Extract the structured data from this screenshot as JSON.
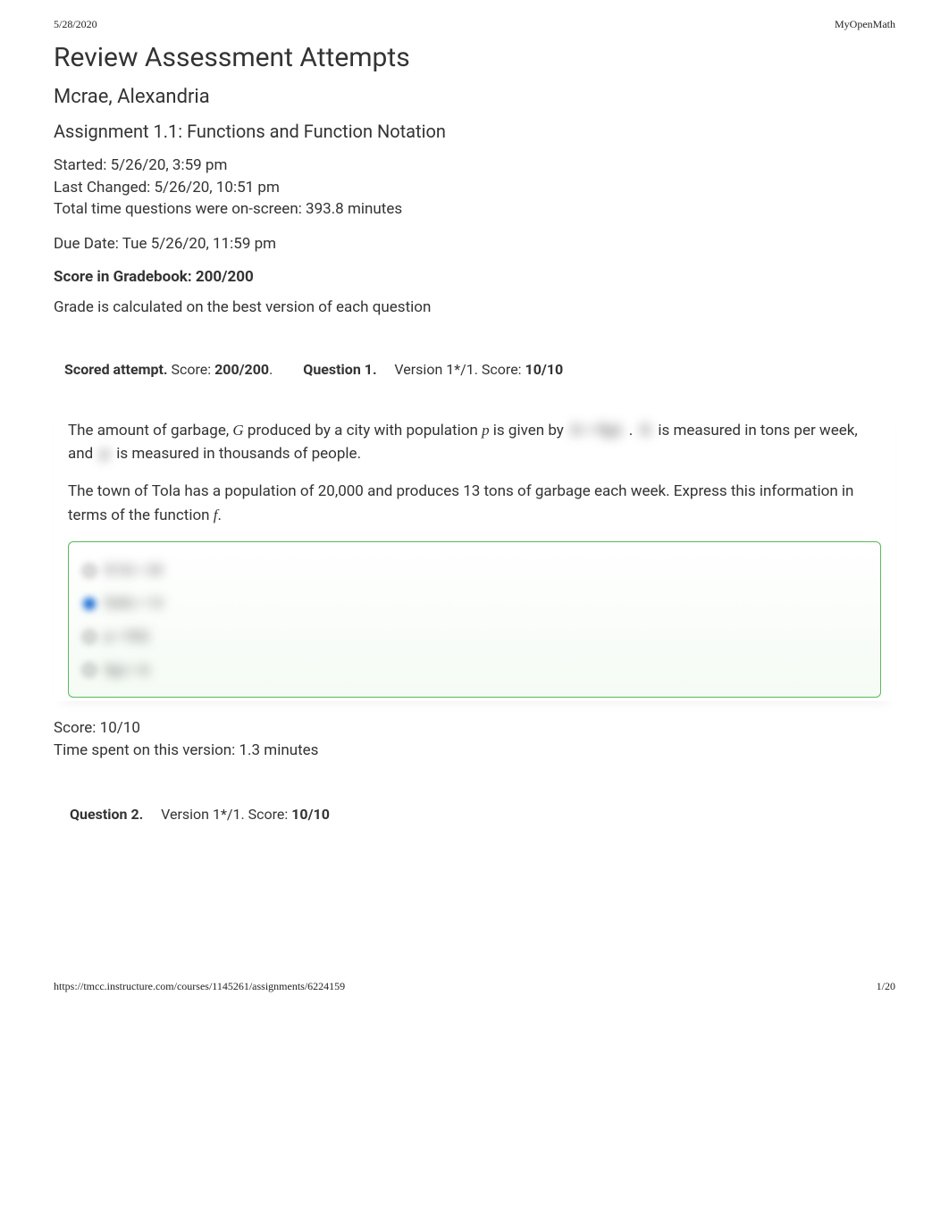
{
  "header": {
    "date": "5/28/2020",
    "app_name": "MyOpenMath"
  },
  "title": "Review Assessment Attempts",
  "student": "Mcrae, Alexandria",
  "assignment": "Assignment 1.1: Functions and Function Notation",
  "meta": {
    "started": "Started: 5/26/20, 3:59 pm",
    "last_changed": "Last Changed: 5/26/20, 10:51 pm",
    "time_onscreen": "Total time questions were on-screen: 393.8 minutes",
    "due_date": "Due Date: Tue 5/26/20, 11:59 pm"
  },
  "gradebook": {
    "label": "Score in Gradebook: ",
    "value": "200/200"
  },
  "grade_note": "Grade is calculated on the best version of each question",
  "attempt_tab": {
    "label": "Scored attempt.",
    "score_label": " Score: ",
    "score_value": "200/200",
    "period": "."
  },
  "q1": {
    "label": "Question 1.",
    "version": "Version 1*/1. Score: ",
    "score": "10/10",
    "text_a": "The amount of garbage, ",
    "var_G": "G",
    "text_b": " produced by a city with population ",
    "var_p": "p",
    "text_c": " is given by ",
    "blur1": "G = f(p)",
    "text_d": " . ",
    "blur2": "G",
    "text_e": " is measured in tons per week, and ",
    "blur3": "p",
    "text_f": " is measured in thousands of people.",
    "para2_a": "The town of Tola has a population of 20,000 and produces 13 tons of garbage each week. Express this information in terms of the function ",
    "var_f": "f",
    "para2_b": ".",
    "options": [
      "f(13) = 20",
      "f(20) = 13",
      "p = f(G)",
      "f(p) = G"
    ],
    "result_score": "Score: 10/10",
    "time_spent": "Time spent on this version: 1.3 minutes"
  },
  "q2": {
    "label": "Question 2.",
    "version": "Version 1*/1. Score: ",
    "score": "10/10"
  },
  "footer": {
    "url": "https://tmcc.instructure.com/courses/1145261/assignments/6224159",
    "page": "1/20"
  }
}
